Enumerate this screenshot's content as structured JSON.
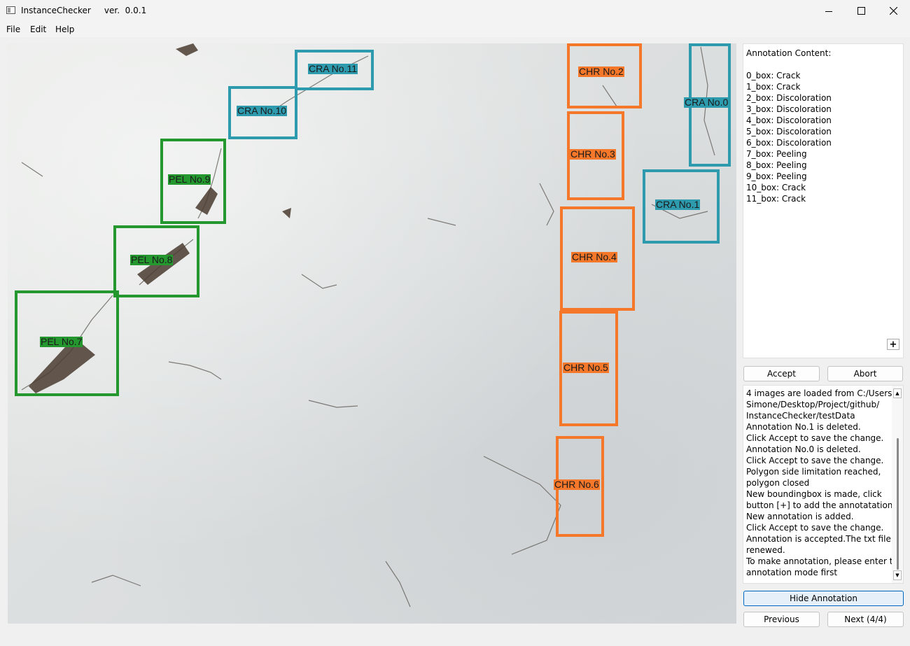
{
  "window": {
    "title": "InstanceChecker     ver.  0.0.1"
  },
  "menu": {
    "file": "File",
    "edit": "Edit",
    "help": "Help"
  },
  "canvas": {
    "colors": {
      "crack": "#2e9aae",
      "discoloration": "#f5772a",
      "peeling": "#24972f"
    },
    "labels": {
      "cra0": "CRA No.0",
      "cra1": "CRA No.1",
      "chr2": "CHR No.2",
      "chr3": "CHR No.3",
      "chr4": "CHR No.4",
      "chr5": "CHR No.5",
      "chr6": "CHR No.6",
      "pel7": "PEL No.7",
      "pel8": "PEL No.8",
      "pel9": "PEL No.9",
      "cra10": "CRA No.10",
      "cra11": "CRA No.11"
    }
  },
  "annotation_panel": {
    "content": "Annotation Content:\n\n0_box: Crack\n1_box: Crack\n2_box: Discoloration\n3_box: Discoloration\n4_box: Discoloration\n5_box: Discoloration\n6_box: Discoloration\n7_box: Peeling\n8_box: Peeling\n9_box: Peeling\n10_box: Crack\n11_box: Crack",
    "add_label": "+"
  },
  "buttons": {
    "accept": "Accept",
    "abort": "Abort",
    "hide_annotation": "Hide Annotation",
    "previous": "Previous",
    "next": "Next (4/4)"
  },
  "log": {
    "lines": [
      "4 images are loaded from C:/Users/",
      "Simone/Desktop/Project/github/",
      "InstanceChecker/testData",
      "Annotation No.1 is deleted.",
      "Click Accept to save the change.",
      "Annotation No.0 is deleted.",
      "Click Accept to save the change.",
      "Polygon side limitation reached,",
      "polygon closed",
      "New boundingbox is made, click",
      "button [+] to add the annotatation.",
      "New annotation is added.",
      "Click Accept to save the change.",
      "Annotation is accepted.The txt file is",
      "renewed.",
      "To make annotation, please enter the",
      "annotation mode first"
    ]
  }
}
